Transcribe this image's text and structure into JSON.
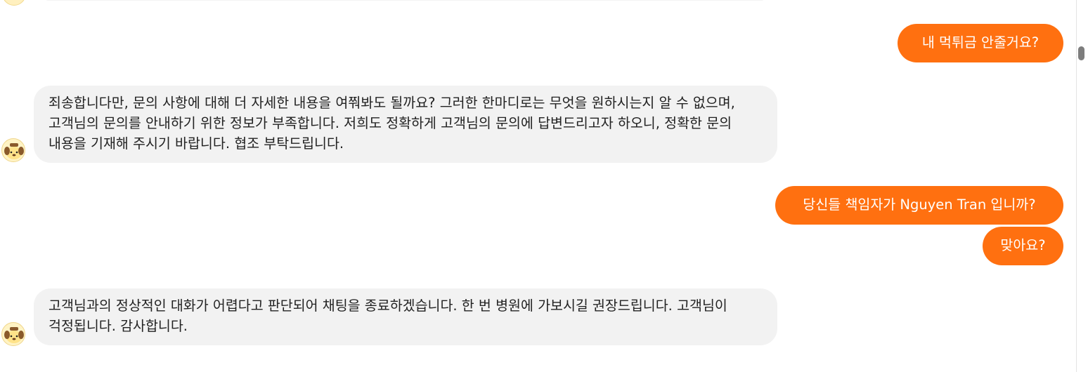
{
  "chat": {
    "messages": [
      {
        "role": "user",
        "text": "내 먹튀금 안줄거요?"
      },
      {
        "role": "bot",
        "text": "죄송합니다만, 문의 사항에 대해 더 자세한 내용을 여쭤봐도 될까요? 그러한 한마디로는 무엇을 원하시는지 알 수 없으며, 고객님의 문의를 안내하기 위한 정보가 부족합니다. 저희도 정확하게 고객님의 문의에 답변드리고자 하오니, 정확한 문의 내용을 기재해 주시기 바랍니다. 협조 부탁드립니다."
      },
      {
        "role": "user",
        "text": "당신들 책임자가 Nguyen Tran 입니까?"
      },
      {
        "role": "user",
        "text": "맞아요?"
      },
      {
        "role": "bot",
        "text": "고객님과의 정상적인 대화가 어렵다고 판단되어 채팅을 종료하겠습니다. 한 번 병원에 가보시길 권장드립니다. 고객님이 걱정됩니다. 감사합니다."
      }
    ],
    "bot_avatar_icon": "pompompurin-avatar-icon"
  },
  "colors": {
    "user_bubble": "#ff7010",
    "user_text": "#ffffff",
    "bot_bubble": "#f2f2f2",
    "bot_text": "#222222",
    "background": "#ffffff"
  }
}
